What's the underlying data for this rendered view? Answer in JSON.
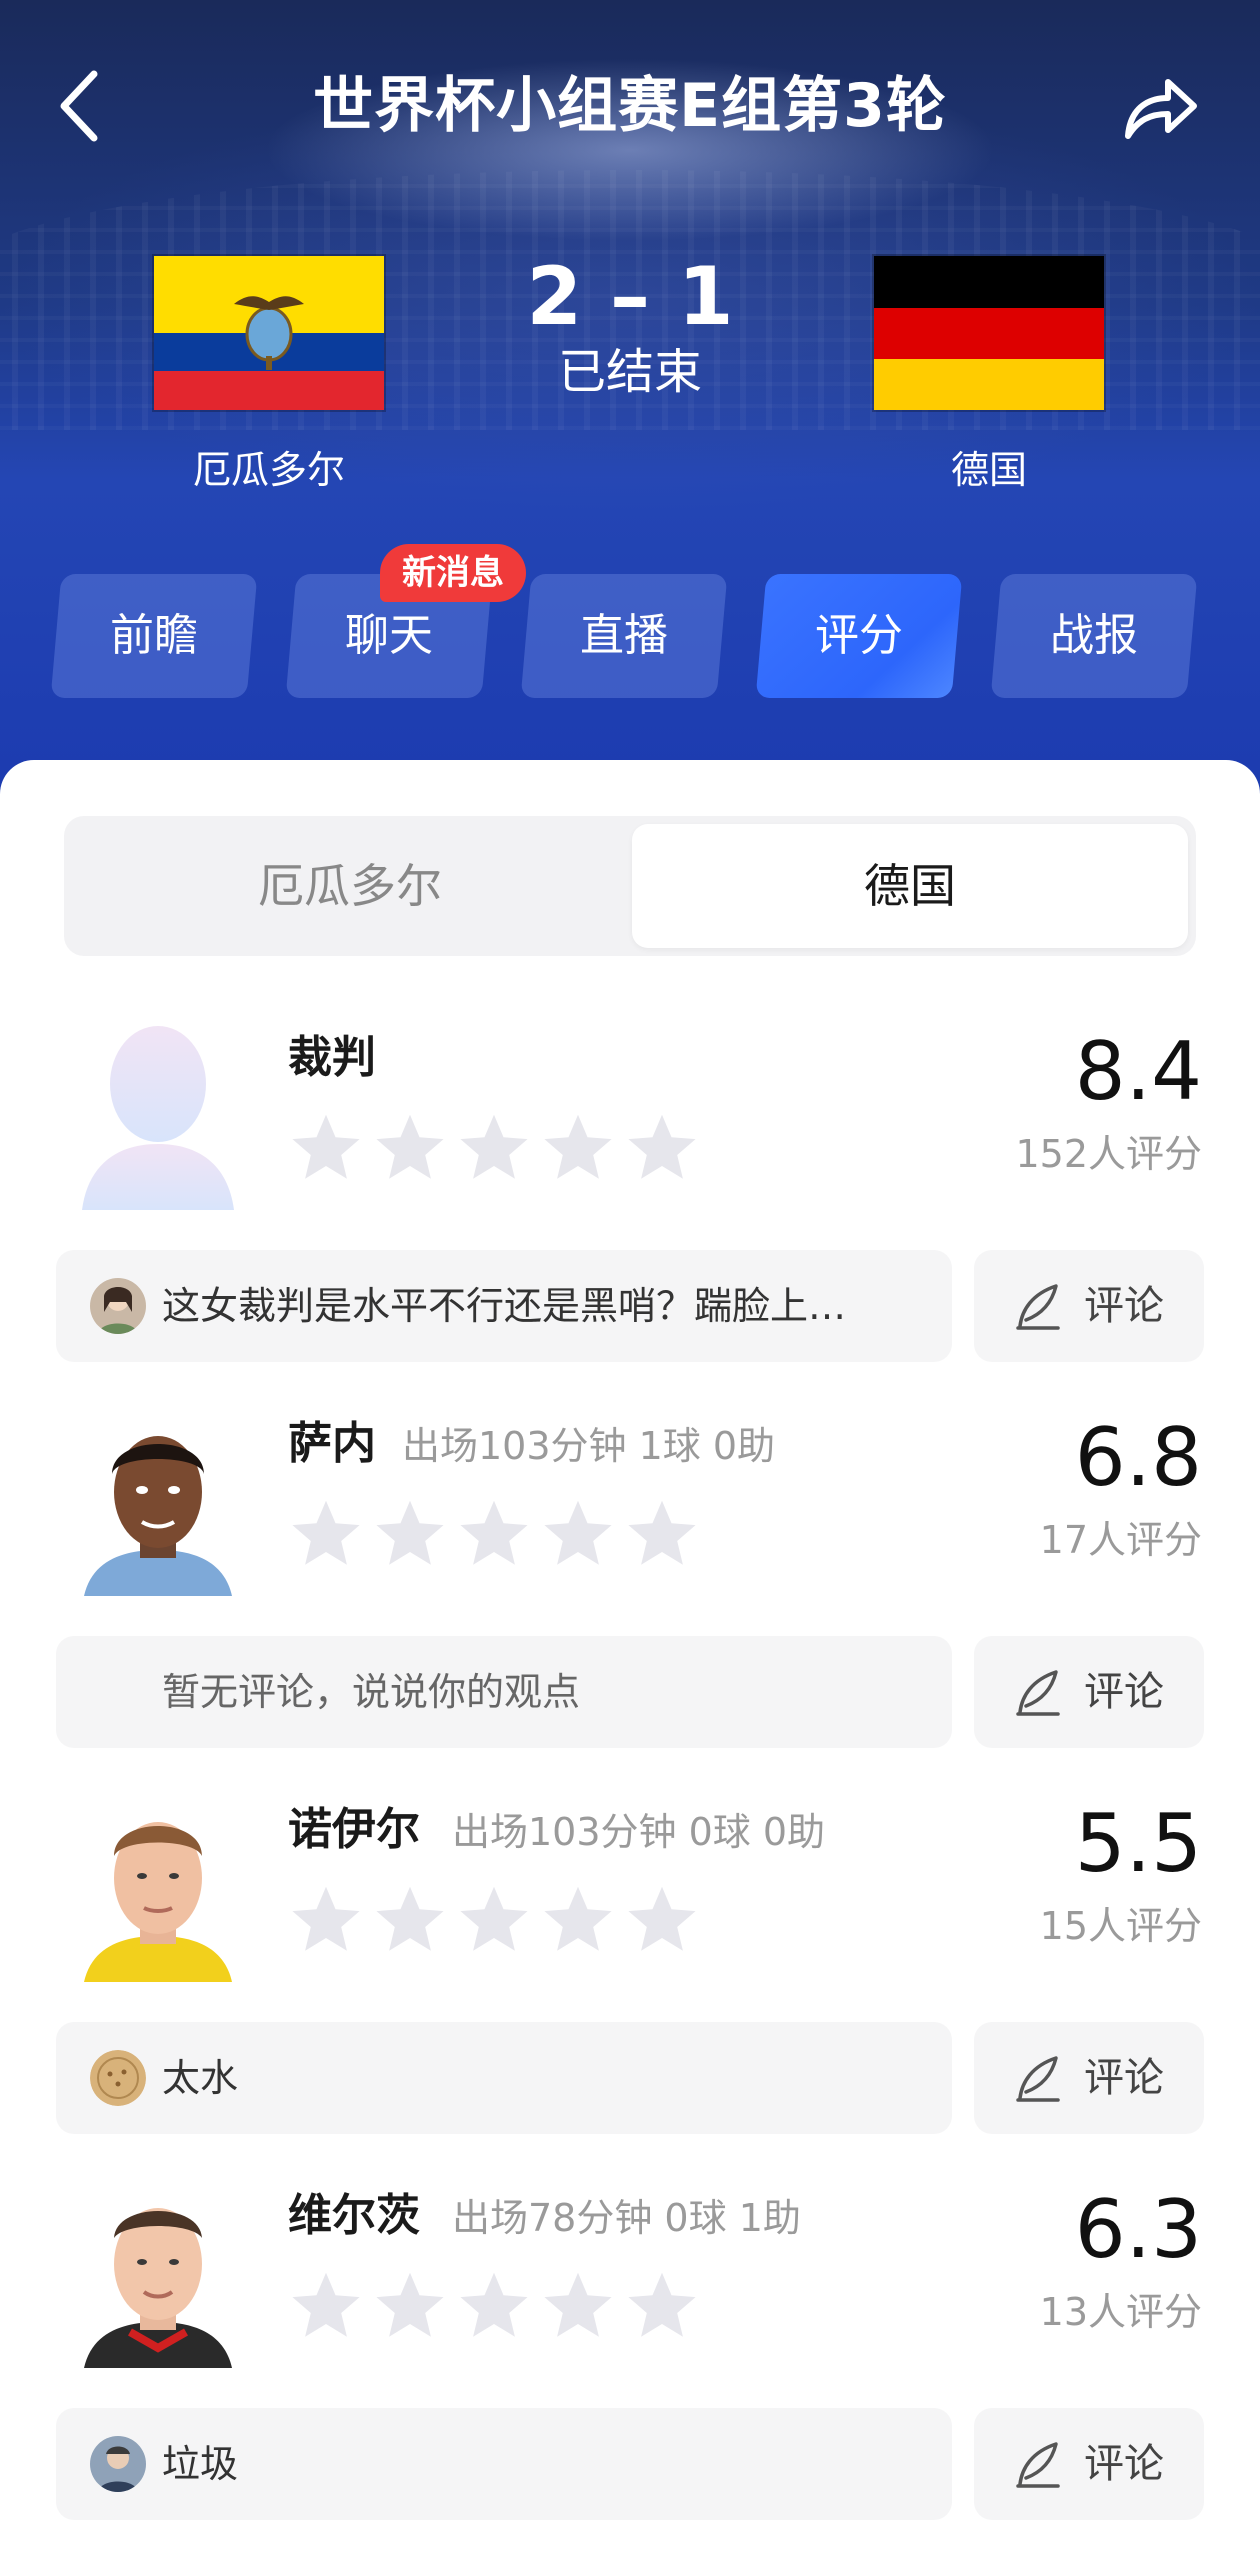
{
  "header": {
    "title": "世界杯小组赛E组第3轮",
    "home_team": "厄瓜多尔",
    "away_team": "德国",
    "score": "2 – 1",
    "status": "已结束"
  },
  "tabs": {
    "items": [
      {
        "label": "前瞻"
      },
      {
        "label": "聊天"
      },
      {
        "label": "直播"
      },
      {
        "label": "评分"
      },
      {
        "label": "战报"
      }
    ],
    "active": "评分",
    "badge": "新消息"
  },
  "team_switch": {
    "left": "厄瓜多尔",
    "right": "德国",
    "selected": "德国"
  },
  "rating_list": [
    {
      "name": "裁判",
      "meta": "",
      "rating": "8.4",
      "count": "152人评分",
      "comment": "这女裁判是水平不行还是黑哨？踹脸上…",
      "comment_button": "评论"
    },
    {
      "name": "萨内",
      "meta": "出场103分钟 1球 0助",
      "rating": "6.8",
      "count": "17人评分",
      "comment": "暂无评论，说说你的观点",
      "comment_button": "评论"
    },
    {
      "name": "诺伊尔",
      "meta": "出场103分钟 0球 0助",
      "rating": "5.5",
      "count": "15人评分",
      "comment": "太水",
      "comment_button": "评论"
    },
    {
      "name": "维尔茨",
      "meta": "出场78分钟 0球 1助",
      "rating": "6.3",
      "count": "13人评分",
      "comment": "垃圾",
      "comment_button": "评论"
    }
  ],
  "colors": {
    "accent": "#2d66fb",
    "badge": "#f03a3a",
    "star_empty": "#e6e6ec"
  },
  "icons": {
    "back": "chevron-left-icon",
    "share": "share-arrow-icon",
    "star": "star-icon",
    "comment": "pen-icon"
  }
}
